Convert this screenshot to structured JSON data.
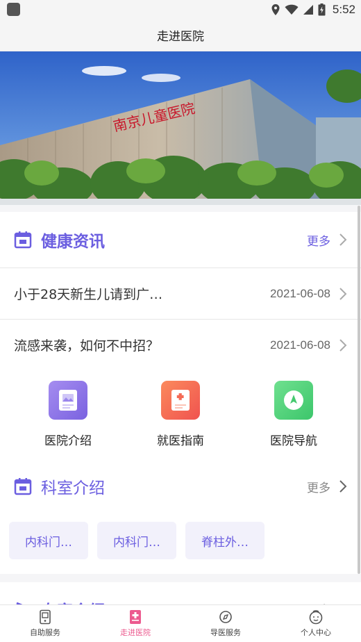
{
  "status": {
    "time": "5:52"
  },
  "header": {
    "title": "走进医院"
  },
  "health_news": {
    "title": "健康资讯",
    "more": "更多",
    "items": [
      {
        "title": "小于28天新生儿请到广…",
        "date": "2021-06-08"
      },
      {
        "title": "流感来袭，如何不中招？",
        "date": "2021-06-08"
      }
    ]
  },
  "quick_links": [
    {
      "label": "医院介绍",
      "icon": "hospital-intro-icon",
      "color": "#8b74e6"
    },
    {
      "label": "就医指南",
      "icon": "medical-guide-icon",
      "color": "#f57257"
    },
    {
      "label": "医院导航",
      "icon": "navigation-icon",
      "color": "#4fd17a"
    }
  ],
  "departments": {
    "title": "科室介绍",
    "more": "更多",
    "tags": [
      "内科门…",
      "内科门…",
      "脊柱外…"
    ]
  },
  "experts": {
    "title": "专家介绍",
    "more": "更多"
  },
  "tabs": [
    {
      "label": "自助服务",
      "icon": "self-service-icon",
      "active": false
    },
    {
      "label": "走进医院",
      "icon": "hospital-icon",
      "active": true
    },
    {
      "label": "导医服务",
      "icon": "compass-icon",
      "active": false
    },
    {
      "label": "个人中心",
      "icon": "person-icon",
      "active": false
    }
  ],
  "colors": {
    "accent": "#6b5ee0",
    "active_tab": "#ec5b8f"
  }
}
